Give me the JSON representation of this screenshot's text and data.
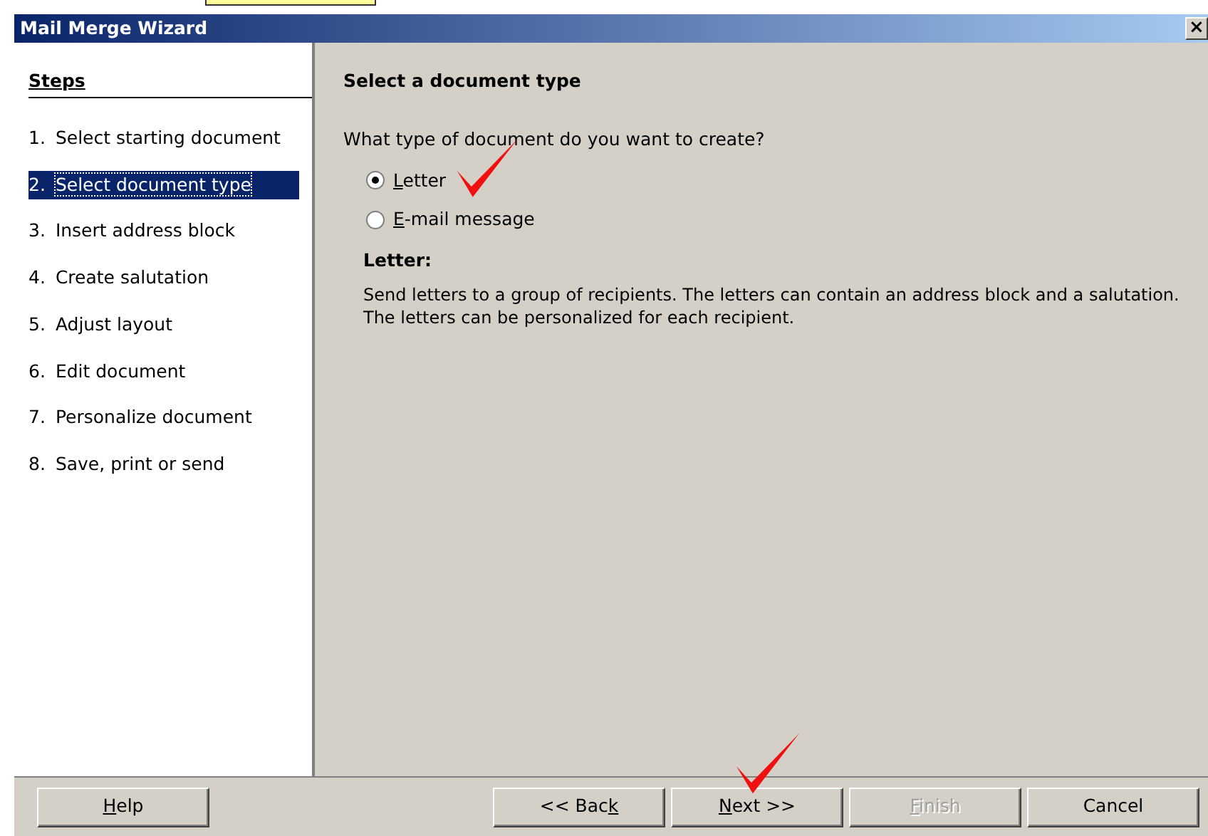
{
  "window": {
    "title": "Mail Merge Wizard",
    "close": "×"
  },
  "steps": {
    "heading": "Steps",
    "items": [
      {
        "number": "1.",
        "label": "Select starting document",
        "selected": false
      },
      {
        "number": "2.",
        "label": "Select document type",
        "selected": true
      },
      {
        "number": "3.",
        "label": "Insert address block",
        "selected": false
      },
      {
        "number": "4.",
        "label": "Create salutation",
        "selected": false
      },
      {
        "number": "5.",
        "label": "Adjust layout",
        "selected": false
      },
      {
        "number": "6.",
        "label": "Edit document",
        "selected": false
      },
      {
        "number": "7.",
        "label": "Personalize document",
        "selected": false
      },
      {
        "number": "8.",
        "label": "Save, print or send",
        "selected": false
      }
    ]
  },
  "page": {
    "title": "Select a document type",
    "question": "What type of document do you want to create?",
    "options": [
      {
        "key": "L",
        "post": "etter",
        "checked": true,
        "annotated": true
      },
      {
        "key": "E",
        "post": "-mail message",
        "checked": false,
        "annotated": false
      }
    ],
    "description_title": "Letter:",
    "description": "Send letters to a group of recipients. The letters can contain an address block and a salutation. The letters can be personalized for each recipient."
  },
  "buttons": [
    {
      "key": "H",
      "post": "elp",
      "disabled": false,
      "annotated": false
    },
    {
      "pre": "<< Bac",
      "key": "k",
      "disabled": false,
      "annotated": false
    },
    {
      "key": "N",
      "post": "ext >>",
      "disabled": false,
      "annotated": true
    },
    {
      "key": "F",
      "post": "inish",
      "disabled": true,
      "annotated": false
    },
    {
      "pre": "Cancel",
      "disabled": false,
      "annotated": false
    }
  ]
}
